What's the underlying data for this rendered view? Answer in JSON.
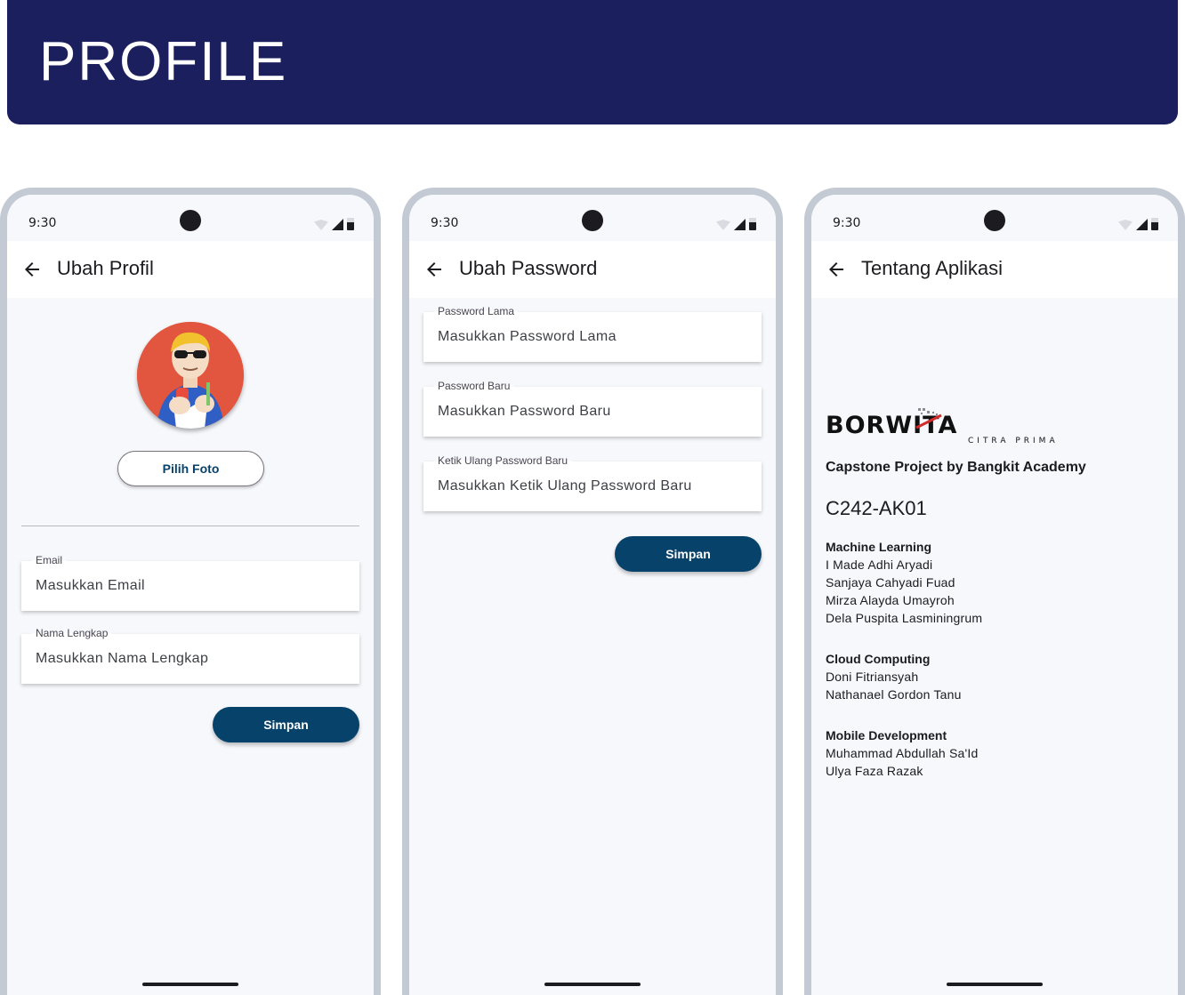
{
  "banner": {
    "title": "PROFILE"
  },
  "status_bar": {
    "time": "9:30"
  },
  "colors": {
    "banner": "#1b1f5e",
    "primary_button": "#06426a",
    "avatar_bg": "#e2563f"
  },
  "screens": {
    "edit_profile": {
      "title": "Ubah Profil",
      "pick_photo_label": "Pilih Foto",
      "email": {
        "label": "Email",
        "placeholder": "Masukkan Email",
        "value": ""
      },
      "full_name": {
        "label": "Nama Lengkap",
        "placeholder": "Masukkan Nama Lengkap",
        "value": ""
      },
      "save_label": "Simpan"
    },
    "change_password": {
      "title": "Ubah Password",
      "old_password": {
        "label": "Password Lama",
        "placeholder": "Masukkan Password Lama",
        "value": ""
      },
      "new_password": {
        "label": "Password Baru",
        "placeholder": "Masukkan Password Baru",
        "value": ""
      },
      "confirm_password": {
        "label": "Ketik Ulang Password Baru",
        "placeholder": "Masukkan Ketik Ulang Password Baru",
        "value": ""
      },
      "save_label": "Simpan"
    },
    "about": {
      "title": "Tentang Aplikasi",
      "logo": {
        "main": "BORWITA",
        "sub": "CITRA PRIMA"
      },
      "heading": "Capstone Project by Bangkit Academy",
      "team_code": "C242-AK01",
      "sections": [
        {
          "title": "Machine Learning",
          "members": [
            "I Made Adhi Aryadi",
            "Sanjaya Cahyadi Fuad",
            "Mirza Alayda Umayroh",
            "Dela Puspita Lasminingrum"
          ]
        },
        {
          "title": "Cloud Computing",
          "members": [
            "Doni Fitriansyah",
            "Nathanael Gordon Tanu"
          ]
        },
        {
          "title": "Mobile Development",
          "members": [
            "Muhammad Abdullah Sa'Id",
            "Ulya Faza Razak"
          ]
        }
      ]
    }
  }
}
